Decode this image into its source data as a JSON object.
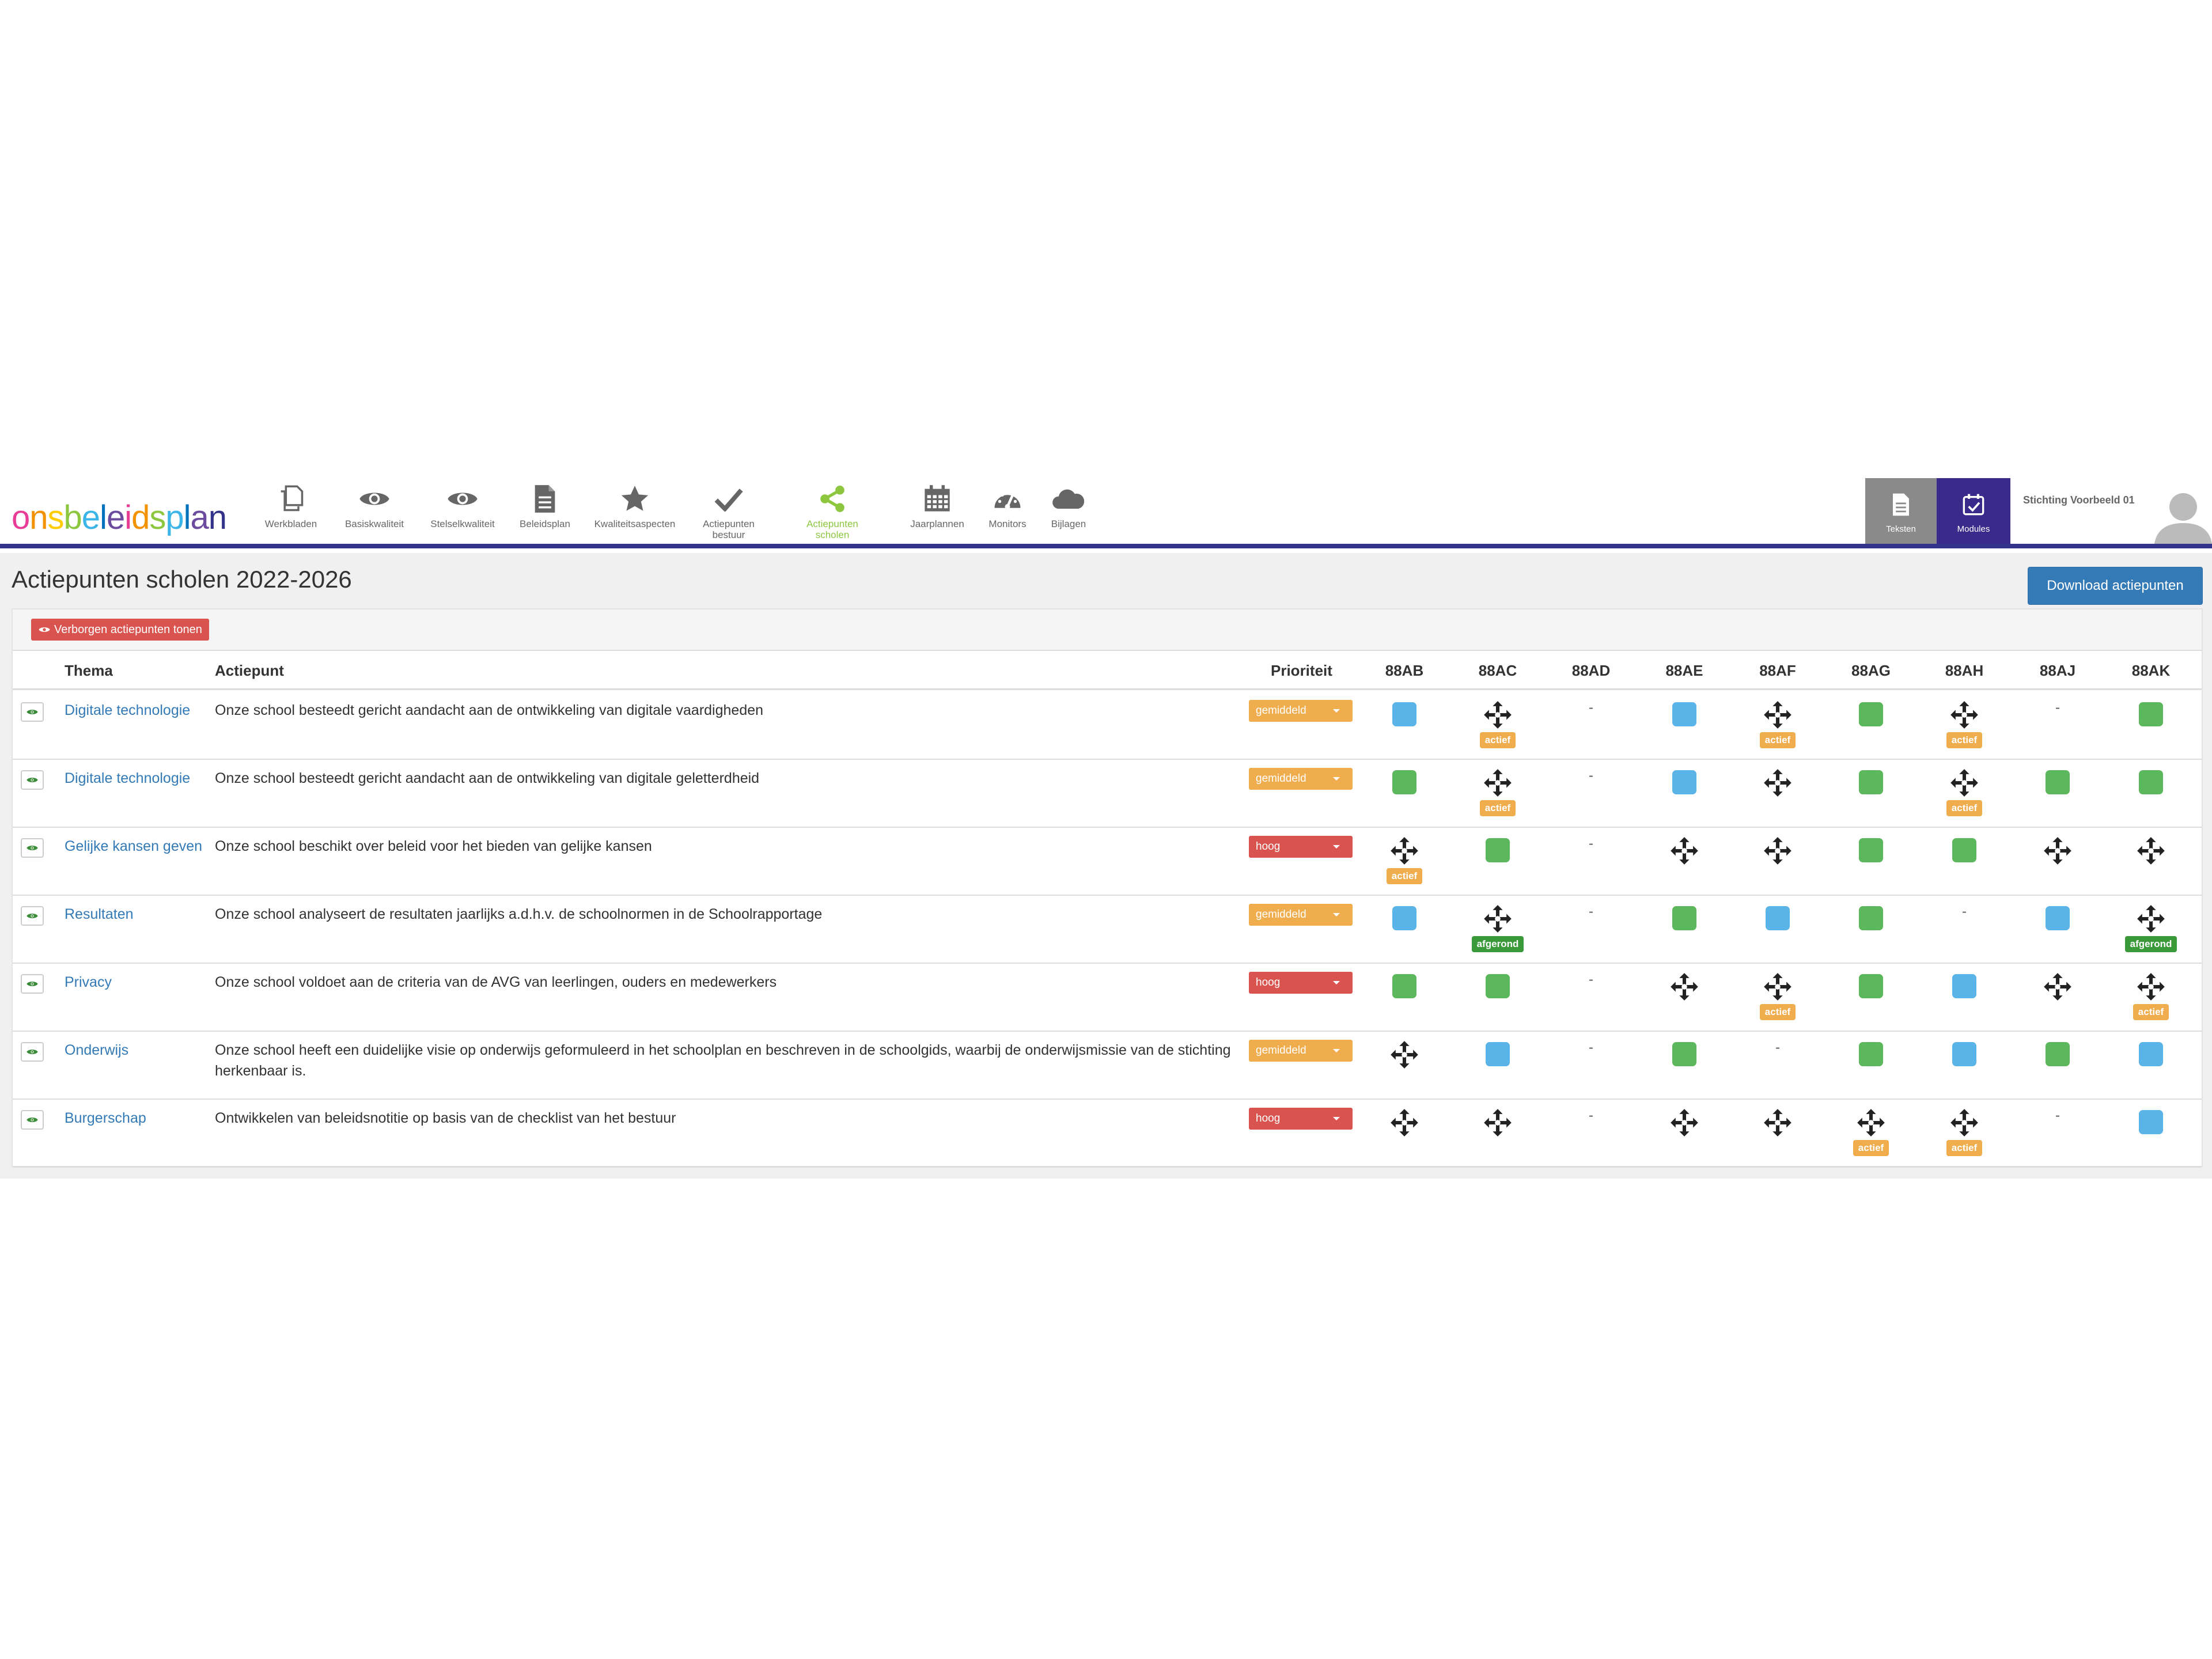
{
  "brand": {
    "logo_letters": [
      "o",
      "n",
      "s",
      "b",
      "e",
      "l",
      "e",
      "i",
      "d",
      "s",
      "p",
      "l",
      "a",
      "n"
    ],
    "logo_colors": [
      "#e83c96",
      "#f29200",
      "#ffcc00",
      "#8dc63f",
      "#3bb4e8",
      "#0072bc",
      "#6c4a9e",
      "#e83c96",
      "#f29200",
      "#8dc63f",
      "#3bb4e8",
      "#0072bc",
      "#6c4a9e",
      "#33338c"
    ]
  },
  "nav": {
    "items": [
      {
        "label": "Werkbladen",
        "icon": "copy-icon"
      },
      {
        "label": "Basiskwaliteit",
        "icon": "eye-icon"
      },
      {
        "label": "Stelselkwaliteit",
        "icon": "eye-icon"
      },
      {
        "label": "Beleidsplan",
        "icon": "document-icon"
      },
      {
        "label": "Kwaliteitsaspecten",
        "icon": "star-icon"
      },
      {
        "label": "Actiepunten bestuur",
        "icon": "check-icon"
      },
      {
        "label": "Actiepunten scholen",
        "icon": "share-icon",
        "active": true
      },
      {
        "label": "Jaarplannen",
        "icon": "calendar-icon"
      },
      {
        "label": "Monitors",
        "icon": "dashboard-icon"
      },
      {
        "label": "Bijlagen",
        "icon": "cloud-icon"
      }
    ],
    "teksten_label": "Teksten",
    "modules_label": "Modules",
    "org_name": "Stichting Voorbeeld 01"
  },
  "page": {
    "title": "Actiepunten scholen 2022-2026",
    "download_label": "Download actiepunten",
    "hidden_toggle_label": "Verborgen actiepunten tonen"
  },
  "table": {
    "headers": {
      "thema": "Thema",
      "actiepunt": "Actiepunt",
      "prioriteit": "Prioriteit",
      "schools": [
        "88AB",
        "88AC",
        "88AD",
        "88AE",
        "88AF",
        "88AG",
        "88AH",
        "88AJ",
        "88AK"
      ]
    },
    "rows": [
      {
        "thema": "Digitale technologie",
        "actiepunt": "Onze school besteedt gericht aandacht aan de ontwikkeling van digitale vaardigheden",
        "prioriteit": "gemiddeld",
        "prio_color": "orange",
        "cells": [
          {
            "type": "blue"
          },
          {
            "type": "move",
            "badge": "actief",
            "badge_color": "orange"
          },
          {
            "type": "dash",
            "text": "-"
          },
          {
            "type": "blue"
          },
          {
            "type": "move",
            "badge": "actief",
            "badge_color": "orange"
          },
          {
            "type": "green"
          },
          {
            "type": "move",
            "badge": "actief",
            "badge_color": "orange"
          },
          {
            "type": "dash",
            "text": "-"
          },
          {
            "type": "green"
          }
        ]
      },
      {
        "thema": "Digitale technologie",
        "actiepunt": "Onze school besteedt gericht aandacht aan de ontwikkeling van digitale geletterdheid",
        "prioriteit": "gemiddeld",
        "prio_color": "orange",
        "cells": [
          {
            "type": "green"
          },
          {
            "type": "move",
            "badge": "actief",
            "badge_color": "orange"
          },
          {
            "type": "dash",
            "text": "-"
          },
          {
            "type": "blue"
          },
          {
            "type": "move"
          },
          {
            "type": "green"
          },
          {
            "type": "move",
            "badge": "actief",
            "badge_color": "orange"
          },
          {
            "type": "green"
          },
          {
            "type": "green"
          }
        ]
      },
      {
        "thema": "Gelijke kansen geven",
        "actiepunt": "Onze school beschikt over beleid voor het bieden van gelijke kansen",
        "prioriteit": "hoog",
        "prio_color": "red",
        "cells": [
          {
            "type": "move",
            "badge": "actief",
            "badge_color": "orange"
          },
          {
            "type": "green"
          },
          {
            "type": "dash",
            "text": "-"
          },
          {
            "type": "move"
          },
          {
            "type": "move"
          },
          {
            "type": "green"
          },
          {
            "type": "green"
          },
          {
            "type": "move"
          },
          {
            "type": "move"
          }
        ]
      },
      {
        "thema": "Resultaten",
        "actiepunt": "Onze school analyseert de resultaten jaarlijks a.d.h.v. de schoolnormen in de Schoolrapportage",
        "prioriteit": "gemiddeld",
        "prio_color": "orange",
        "cells": [
          {
            "type": "blue"
          },
          {
            "type": "move",
            "badge": "afgerond",
            "badge_color": "green"
          },
          {
            "type": "dash",
            "text": "-"
          },
          {
            "type": "green"
          },
          {
            "type": "blue"
          },
          {
            "type": "green"
          },
          {
            "type": "dash",
            "text": "-"
          },
          {
            "type": "blue"
          },
          {
            "type": "move",
            "badge": "afgerond",
            "badge_color": "green"
          }
        ]
      },
      {
        "thema": "Privacy",
        "actiepunt": "Onze school voldoet aan de criteria van de AVG van leerlingen, ouders en medewerkers",
        "prioriteit": "hoog",
        "prio_color": "red",
        "cells": [
          {
            "type": "green"
          },
          {
            "type": "green"
          },
          {
            "type": "dash",
            "text": "-"
          },
          {
            "type": "move"
          },
          {
            "type": "move",
            "badge": "actief",
            "badge_color": "orange"
          },
          {
            "type": "green"
          },
          {
            "type": "blue"
          },
          {
            "type": "move"
          },
          {
            "type": "move",
            "badge": "actief",
            "badge_color": "orange"
          }
        ]
      },
      {
        "thema": "Onderwijs",
        "actiepunt": "Onze school heeft een duidelijke visie op onderwijs geformuleerd in het schoolplan en beschreven in de schoolgids, waarbij de onderwijsmissie van de stichting herkenbaar is.",
        "prioriteit": "gemiddeld",
        "prio_color": "orange",
        "cells": [
          {
            "type": "move"
          },
          {
            "type": "blue"
          },
          {
            "type": "dash",
            "text": "-"
          },
          {
            "type": "green"
          },
          {
            "type": "dash",
            "text": "-"
          },
          {
            "type": "green"
          },
          {
            "type": "blue"
          },
          {
            "type": "green"
          },
          {
            "type": "blue"
          }
        ]
      },
      {
        "thema": "Burgerschap",
        "actiepunt": "Ontwikkelen van beleidsnotitie op basis van de checklist van het bestuur",
        "prioriteit": "hoog",
        "prio_color": "red",
        "cells": [
          {
            "type": "move"
          },
          {
            "type": "move"
          },
          {
            "type": "dash",
            "text": "-"
          },
          {
            "type": "move"
          },
          {
            "type": "move"
          },
          {
            "type": "move",
            "badge": "actief",
            "badge_color": "orange"
          },
          {
            "type": "move",
            "badge": "actief",
            "badge_color": "orange"
          },
          {
            "type": "dash",
            "text": "-"
          },
          {
            "type": "blue"
          }
        ]
      }
    ]
  }
}
